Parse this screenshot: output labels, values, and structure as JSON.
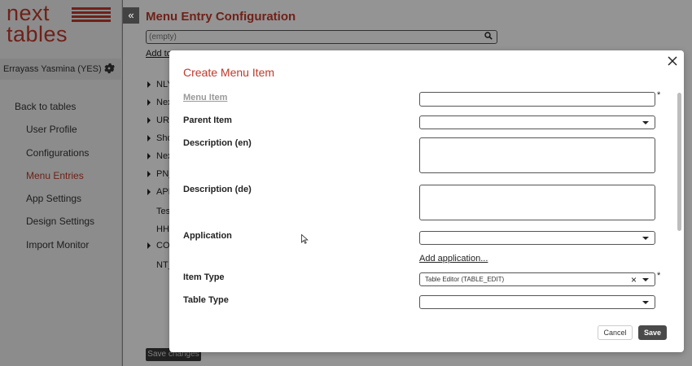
{
  "sidebar": {
    "logo_line1": "next",
    "logo_line2": "tables",
    "user_name": "Errayass Yasmina (YES)",
    "items": [
      {
        "label": "Back to tables"
      },
      {
        "label": "User Profile"
      },
      {
        "label": "Configurations"
      },
      {
        "label": "Menu Entries",
        "active": true
      },
      {
        "label": "App Settings"
      },
      {
        "label": "Design Settings"
      },
      {
        "label": "Import Monitor"
      }
    ]
  },
  "main": {
    "collapse_icon": "«",
    "title": "Menu Entry Configuration",
    "filter_placeholder": "(empty)",
    "add_link": "Add to",
    "tree": [
      {
        "label": "NLY",
        "expandable": true
      },
      {
        "label": "Nex",
        "expandable": true
      },
      {
        "label": "URL",
        "expandable": true
      },
      {
        "label": "Sho",
        "expandable": true
      },
      {
        "label": "Nex",
        "expandable": true
      },
      {
        "label": "PN_",
        "expandable": true
      },
      {
        "label": "API",
        "expandable": true
      },
      {
        "label": "Tes",
        "expandable": false
      },
      {
        "label": "HH",
        "expandable": false
      },
      {
        "label": "COI",
        "expandable": true
      },
      {
        "label": "NT_",
        "expandable": false
      }
    ],
    "save_changes": "Save changes"
  },
  "modal": {
    "title": "Create Menu Item",
    "fields": {
      "menu_item": {
        "label": "Menu Item",
        "value": "",
        "required": true
      },
      "parent_item": {
        "label": "Parent Item",
        "value": ""
      },
      "description_en": {
        "label": "Description (en)",
        "value": ""
      },
      "description_de": {
        "label": "Description (de)",
        "value": ""
      },
      "application": {
        "label": "Application",
        "value": ""
      },
      "item_type": {
        "label": "Item Type",
        "value": "Table Editor (TABLE_EDIT)",
        "required": true
      },
      "table_type": {
        "label": "Table Type",
        "value": ""
      }
    },
    "add_application_link": "Add application...",
    "required_marker": "*",
    "cancel_label": "Cancel",
    "save_label": "Save"
  },
  "colors": {
    "accent": "#c0392b",
    "dark_button": "#4a4a4a"
  }
}
